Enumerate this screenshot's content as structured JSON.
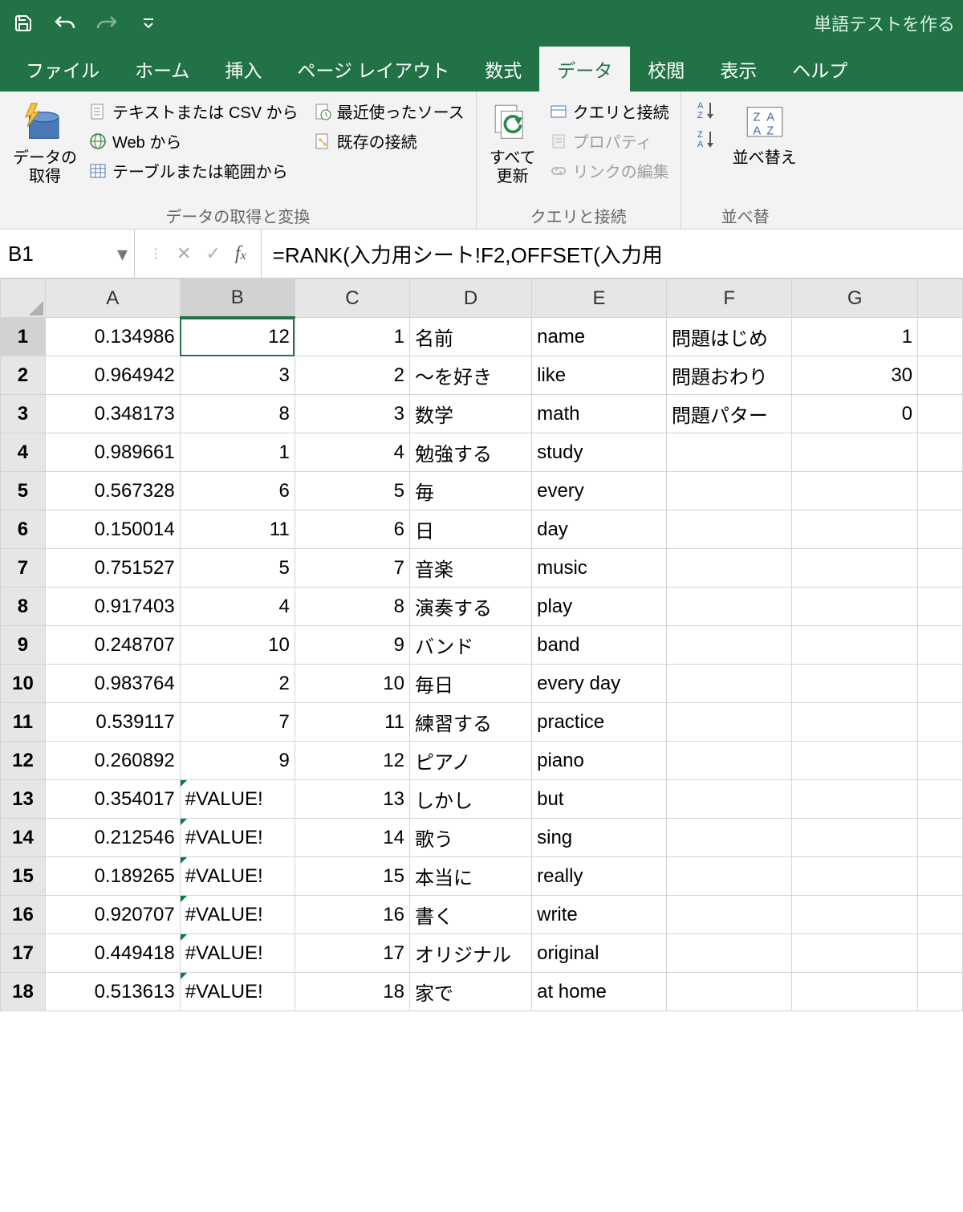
{
  "titlebar": {
    "doc_title": "単語テストを作る"
  },
  "tabs": {
    "file": "ファイル",
    "home": "ホーム",
    "insert": "挿入",
    "pagelayout": "ページ レイアウト",
    "formulas": "数式",
    "data": "データ",
    "review": "校閲",
    "view": "表示",
    "help": "ヘルプ"
  },
  "ribbon": {
    "get_transform_label": "データの取得と変換",
    "queries_conn_label": "クエリと接続",
    "sort_filter_label": "並べ替",
    "get_data": "データの\n取得",
    "from_csv": "テキストまたは CSV から",
    "from_web": "Web から",
    "from_table": "テーブルまたは範囲から",
    "recent_sources": "最近使ったソース",
    "existing_conn": "既存の接続",
    "refresh_all": "すべて\n更新",
    "queries_conn": "クエリと接続",
    "properties": "プロパティ",
    "edit_links": "リンクの編集",
    "sort": "並べ替え"
  },
  "namebox": "B1",
  "formula": "=RANK(入力用シート!F2,OFFSET(入力用",
  "columns": [
    "A",
    "B",
    "C",
    "D",
    "E",
    "F",
    "G"
  ],
  "rows": [
    {
      "n": 1,
      "A": "0.134986",
      "B": "12",
      "C": "1",
      "D": "名前",
      "E": "name",
      "F": "問題はじめ",
      "G": "1"
    },
    {
      "n": 2,
      "A": "0.964942",
      "B": "3",
      "C": "2",
      "D": "～を好き",
      "E": "like",
      "F": "問題おわり",
      "G": "30"
    },
    {
      "n": 3,
      "A": "0.348173",
      "B": "8",
      "C": "3",
      "D": "数学",
      "E": "math",
      "F": "問題パター",
      "G": "0"
    },
    {
      "n": 4,
      "A": "0.989661",
      "B": "1",
      "C": "4",
      "D": "勉強する",
      "E": "study",
      "F": "",
      "G": ""
    },
    {
      "n": 5,
      "A": "0.567328",
      "B": "6",
      "C": "5",
      "D": "毎",
      "E": "every",
      "F": "",
      "G": ""
    },
    {
      "n": 6,
      "A": "0.150014",
      "B": "11",
      "C": "6",
      "D": "日",
      "E": "day",
      "F": "",
      "G": ""
    },
    {
      "n": 7,
      "A": "0.751527",
      "B": "5",
      "C": "7",
      "D": "音楽",
      "E": "music",
      "F": "",
      "G": ""
    },
    {
      "n": 8,
      "A": "0.917403",
      "B": "4",
      "C": "8",
      "D": "演奏する",
      "E": "play",
      "F": "",
      "G": ""
    },
    {
      "n": 9,
      "A": "0.248707",
      "B": "10",
      "C": "9",
      "D": "バンド",
      "E": "band",
      "F": "",
      "G": ""
    },
    {
      "n": 10,
      "A": "0.983764",
      "B": "2",
      "C": "10",
      "D": "毎日",
      "E": "every day",
      "F": "",
      "G": ""
    },
    {
      "n": 11,
      "A": "0.539117",
      "B": "7",
      "C": "11",
      "D": "練習する",
      "E": "practice",
      "F": "",
      "G": ""
    },
    {
      "n": 12,
      "A": "0.260892",
      "B": "9",
      "C": "12",
      "D": "ピアノ",
      "E": "piano",
      "F": "",
      "G": ""
    },
    {
      "n": 13,
      "A": "0.354017",
      "B": "#VALUE!",
      "C": "13",
      "D": "しかし",
      "E": "but",
      "F": "",
      "G": "",
      "err": true
    },
    {
      "n": 14,
      "A": "0.212546",
      "B": "#VALUE!",
      "C": "14",
      "D": "歌う",
      "E": "sing",
      "F": "",
      "G": "",
      "err": true
    },
    {
      "n": 15,
      "A": "0.189265",
      "B": "#VALUE!",
      "C": "15",
      "D": "本当に",
      "E": "really",
      "F": "",
      "G": "",
      "err": true
    },
    {
      "n": 16,
      "A": "0.920707",
      "B": "#VALUE!",
      "C": "16",
      "D": "書く",
      "E": "write",
      "F": "",
      "G": "",
      "err": true
    },
    {
      "n": 17,
      "A": "0.449418",
      "B": "#VALUE!",
      "C": "17",
      "D": "オリジナル",
      "E": "original",
      "F": "",
      "G": "",
      "err": true
    },
    {
      "n": 18,
      "A": "0.513613",
      "B": "#VALUE!",
      "C": "18",
      "D": "家で",
      "E": "at home",
      "F": "",
      "G": "",
      "err": true
    }
  ],
  "selected_cell": "B1"
}
